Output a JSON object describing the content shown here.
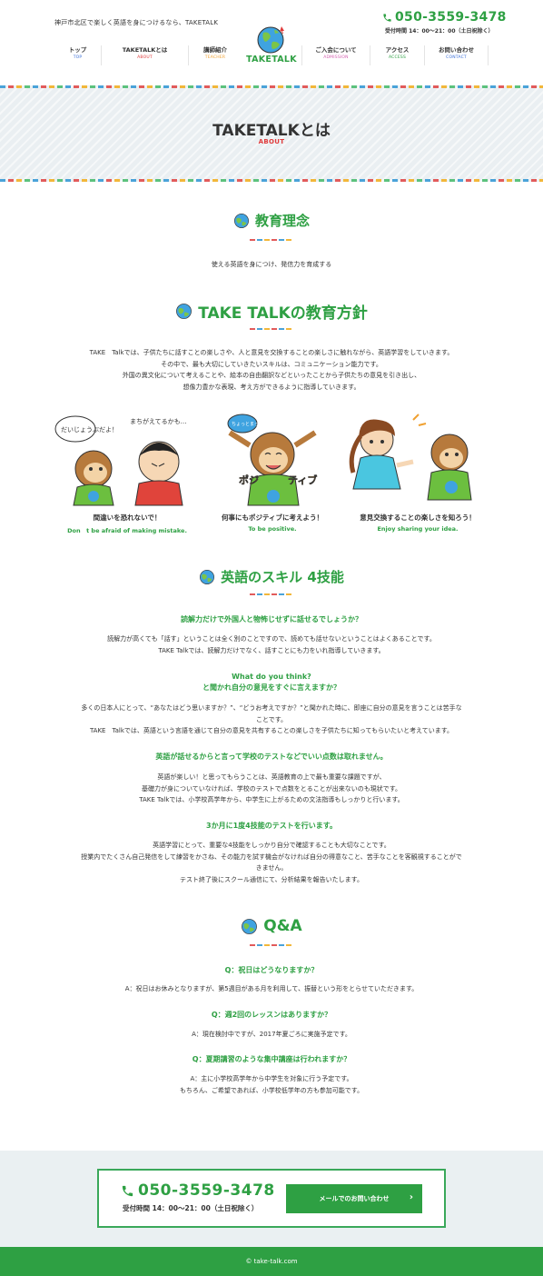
{
  "header": {
    "tagline": "神戸市北区で楽しく英語を身につけるなら、TAKETALK",
    "phone": "050-3559-3478",
    "hours": "受付時間 14：00～21：00（土日祝除く）",
    "logo_text": "TAKETALK",
    "nav": [
      {
        "jp": "トップ",
        "en": "TOP",
        "color": "#3b6fd8"
      },
      {
        "jp": "TAKETALKとは",
        "en": "ABOUT",
        "color": "#e03a3a"
      },
      {
        "jp": "講師紹介",
        "en": "TEACHER",
        "color": "#f0a030"
      },
      {
        "jp": "ご入会について",
        "en": "ADMISSION",
        "color": "#d55fb0"
      },
      {
        "jp": "アクセス",
        "en": "ACCESS",
        "color": "#2ea043"
      },
      {
        "jp": "お問い合わせ",
        "en": "CONTACT",
        "color": "#3b6fd8"
      }
    ]
  },
  "banner": {
    "title": "TAKETALKとは",
    "subtitle": "ABOUT"
  },
  "philosophy": {
    "heading": "教育理念",
    "text": "使える英語を身につけ、発信力を育成する"
  },
  "policy": {
    "heading": "TAKE TALKの教育方針",
    "lines": [
      "TAKE　Talkでは、子供たちに話すことの楽しさや、人と意見を交換することの楽しさに触れながら、英語学習をしていきます。",
      "その中で、最も大切にしていきたいスキルは、コミュニケーション能力です。",
      "外国の異文化について考えることや、絵本の自由翻訳などといったことから子供たちの意見を引き出し、",
      "想像力豊かな表現、考え方ができるように指導していきます。"
    ],
    "bubble1": "だいじょうぶだよ！",
    "bubble2": "まちがえてるかも…",
    "bubble3": "ちょっとまって",
    "pos_text1": "ポジ",
    "pos_text2": "ティブ",
    "illustrations": [
      {
        "jp": "間違いを恐れないで！",
        "en": "Don　t be afraid of making mistake."
      },
      {
        "jp": "何事にもポジティブに考えよう！",
        "en": "To be positive."
      },
      {
        "jp": "意見交換することの楽しさを知ろう！",
        "en": "Enjoy sharing your idea."
      }
    ]
  },
  "skills": {
    "heading": "英語のスキル 4技能",
    "blocks": [
      {
        "q": [
          "読解力だけで外国人と物怖じせずに話せるでしょうか？"
        ],
        "a": [
          "読解力が高くても「話す」ということは全く別のことですので、読めても話せないということはよくあることです。",
          "TAKE Talkでは、読解力だけでなく、話すことにも力をいれ指導していきます。"
        ]
      },
      {
        "q": [
          "What do you think?",
          "と聞かれ自分の意見をすぐに言えますか？"
        ],
        "a": [
          "多くの日本人にとって、“あなたはどう思いますか？”、“どうお考えですか？”と聞かれた時に、即座に自分の意見を言うことは苦手な",
          "ことです。",
          "TAKE　Talkでは、英語という言語を通じて自分の意見を共有することの楽しさを子供たちに知ってもらいたいと考えています。"
        ]
      },
      {
        "q": [
          "英語が話せるからと言って学校のテストなどでいい点数は取れません。"
        ],
        "a": [
          "英語が楽しい！と思ってもらうことは、英語教育の上で最も重要な課題ですが、",
          "基礎力が身についていなければ、学校のテストで点数をとることが出来ないのも現状です。",
          "TAKE Talkでは、小学校高学年から、中学生に上がるための文法指導もしっかりと行います。"
        ]
      },
      {
        "q": [
          "3か月に1度4技能のテストを行います。"
        ],
        "a": [
          "英語学習にとって、重要な4技能をしっかり自分で確認することも大切なことです。",
          "授業内でたくさん自己発信をして練習をかさね、その能力を試す機会がなければ自分の得意なこと、苦手なことを客観視することがで",
          "きません。",
          "テスト終了後にスクール通信にて、分析結果を報告いたします。"
        ]
      }
    ]
  },
  "qa": {
    "heading": "Q&A",
    "items": [
      {
        "q": "Q：祝日はどうなりますか？",
        "a": [
          "A：祝日はお休みとなりますが、第5週目がある月を利用して、振替という形をとらせていただきます。"
        ]
      },
      {
        "q": "Q：週2回のレッスンはありますか？",
        "a": [
          "A：現在検討中ですが、2017年夏ごろに実施予定です。"
        ]
      },
      {
        "q": "Q：夏期講習のような集中講座は行われますか？",
        "a": [
          "A：主に小学校高学年から中学生を対象に行う予定です。",
          "もちろん、ご希望であれば、小学校低学年の方も参加可能です。"
        ]
      }
    ]
  },
  "cta": {
    "phone": "050-3559-3478",
    "hours": "受付時間 14：00～21：00（土日祝除く）",
    "button": "メールでのお問い合わせ",
    "chevron": "›"
  },
  "footer": {
    "copyright": "© take-talk.com"
  },
  "colors": {
    "brand_green": "#2ea043",
    "accent_red": "#e03a3a"
  }
}
